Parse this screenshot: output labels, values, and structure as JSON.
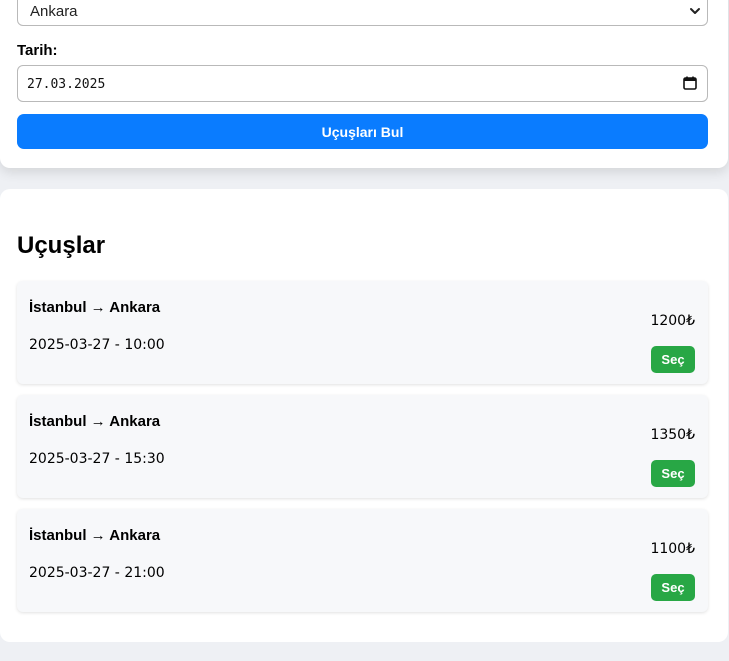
{
  "search": {
    "destination_value": "Ankara",
    "date_label": "Tarih:",
    "date_value": "27.03.2025",
    "submit_label": "Uçuşları Bul"
  },
  "results": {
    "title": "Uçuşlar",
    "flights": [
      {
        "route": "İstanbul → Ankara",
        "datetime": "2025-03-27 - 10:00",
        "price": "1200₺",
        "select_label": "Seç"
      },
      {
        "route": "İstanbul → Ankara",
        "datetime": "2025-03-27 - 15:30",
        "price": "1350₺",
        "select_label": "Seç"
      },
      {
        "route": "İstanbul → Ankara",
        "datetime": "2025-03-27 - 21:00",
        "price": "1100₺",
        "select_label": "Seç"
      }
    ]
  },
  "colors": {
    "primary": "#0a7cff",
    "success": "#28a745",
    "page_background": "#eef0f4"
  }
}
